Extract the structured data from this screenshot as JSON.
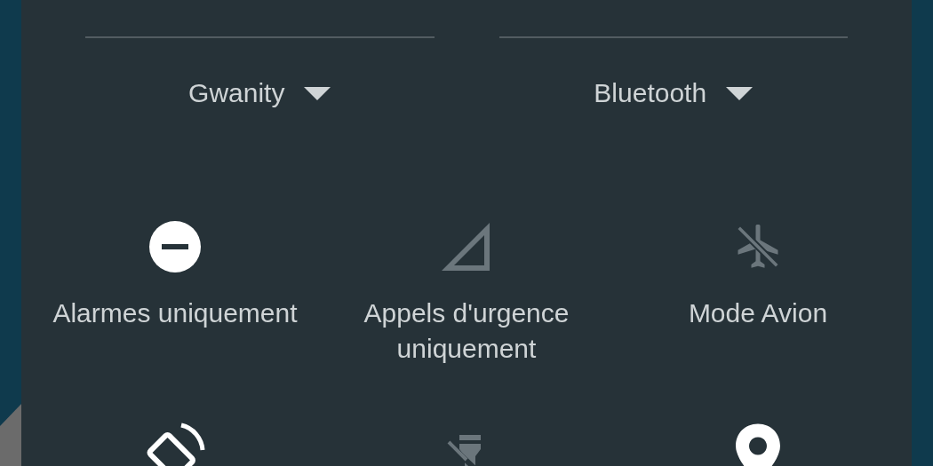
{
  "dropdowns": [
    {
      "label": "Gwanity"
    },
    {
      "label": "Bluetooth"
    }
  ],
  "tiles": [
    {
      "kind": "dnd",
      "label": "Alarmes uniquement",
      "on": true
    },
    {
      "kind": "signal",
      "label": "Appels d'urgence uniquement",
      "on": false
    },
    {
      "kind": "airplane",
      "label": "Mode Avion",
      "on": false
    },
    {
      "kind": "rotate",
      "on": true
    },
    {
      "kind": "flashlight",
      "on": false
    },
    {
      "kind": "location",
      "on": true
    }
  ]
}
